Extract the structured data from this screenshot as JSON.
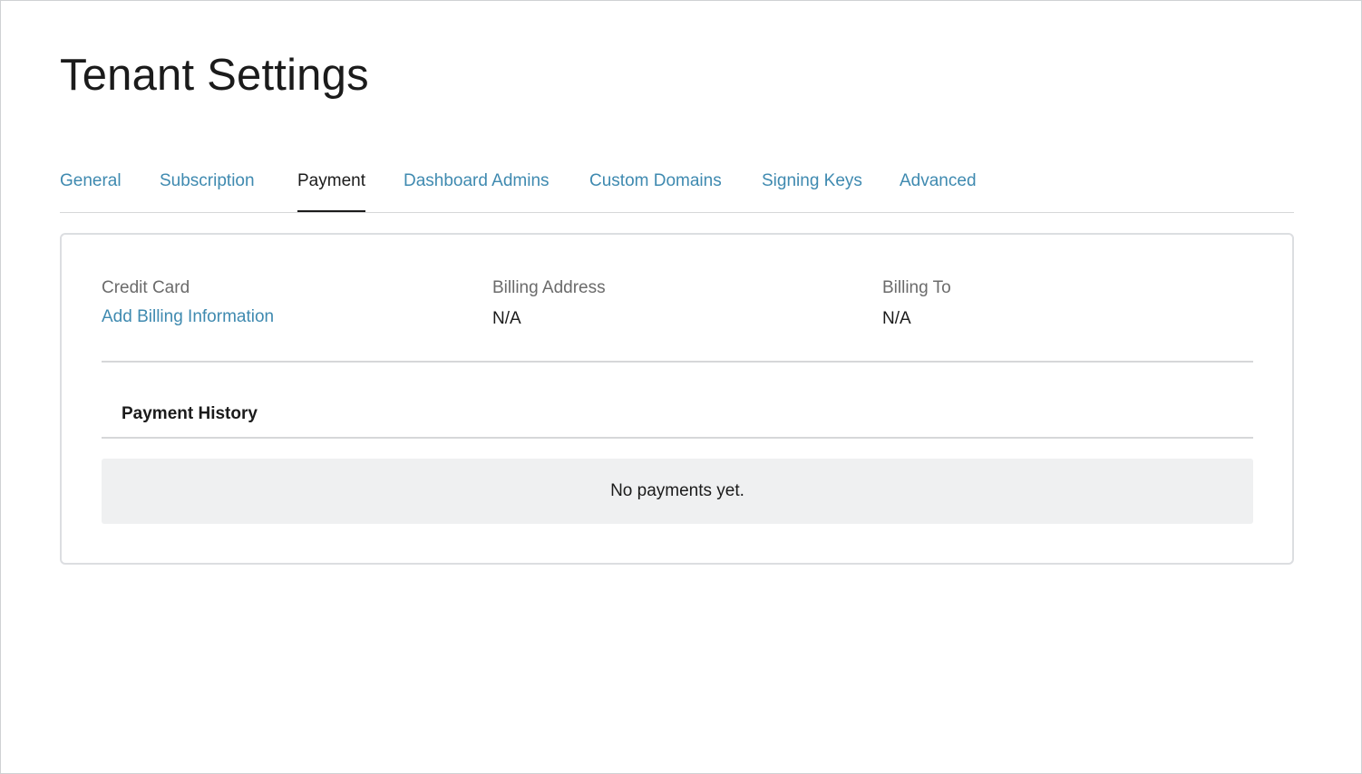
{
  "page": {
    "title": "Tenant Settings"
  },
  "tabs": [
    {
      "label": "General",
      "active": false
    },
    {
      "label": "Subscription",
      "active": false
    },
    {
      "label": "Payment",
      "active": true
    },
    {
      "label": "Dashboard Admins",
      "active": false
    },
    {
      "label": "Custom Domains",
      "active": false
    },
    {
      "label": "Signing Keys",
      "active": false
    },
    {
      "label": "Advanced",
      "active": false
    }
  ],
  "billing": {
    "credit_card": {
      "label": "Credit Card",
      "link": "Add Billing Information"
    },
    "billing_address": {
      "label": "Billing Address",
      "value": "N/A"
    },
    "billing_to": {
      "label": "Billing To",
      "value": "N/A"
    }
  },
  "payment_history": {
    "title": "Payment History",
    "empty_message": "No payments yet."
  },
  "colors": {
    "link": "#3f8ab0",
    "text": "#1b1b1b",
    "muted": "#6b6b6b",
    "divider": "#d6d7d9",
    "empty_bg": "#eff0f1"
  }
}
